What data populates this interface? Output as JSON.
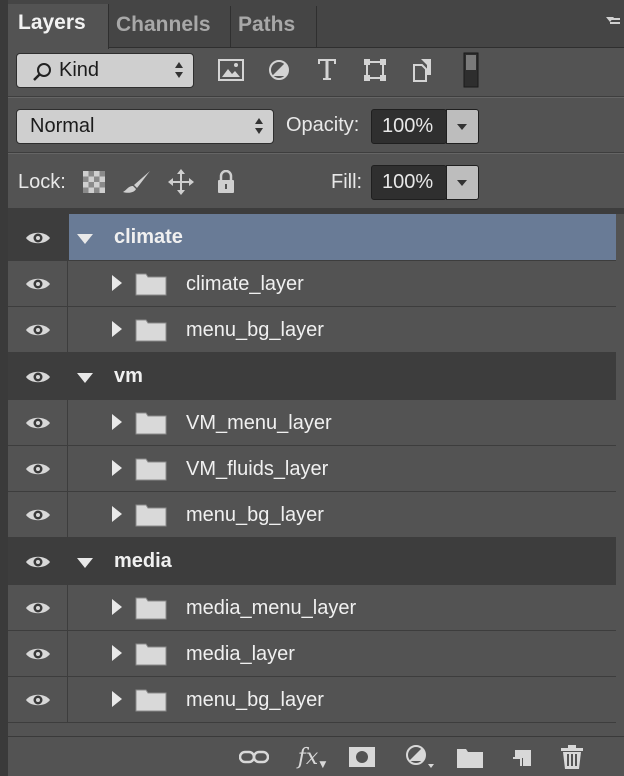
{
  "tabs": [
    {
      "label": "Layers",
      "active": true
    },
    {
      "label": "Channels",
      "active": false
    },
    {
      "label": "Paths",
      "active": false
    }
  ],
  "filter": {
    "kind_label": "Kind",
    "icons": [
      "image-filter-icon",
      "adjustment-filter-icon",
      "type-filter-icon",
      "shape-filter-icon",
      "smart-object-filter-icon",
      "filter-toggle-icon"
    ]
  },
  "blend": {
    "mode": "Normal",
    "opacity_label": "Opacity:",
    "opacity_value": "100%"
  },
  "lock": {
    "label": "Lock:",
    "fill_label": "Fill:",
    "fill_value": "100%"
  },
  "layers": [
    {
      "type": "group",
      "name": "climate",
      "selected": true,
      "expanded": true
    },
    {
      "type": "child",
      "name": "climate_layer"
    },
    {
      "type": "child",
      "name": "menu_bg_layer"
    },
    {
      "type": "group",
      "name": "vm",
      "selected": false,
      "expanded": true
    },
    {
      "type": "child",
      "name": "VM_menu_layer"
    },
    {
      "type": "child",
      "name": "VM_fluids_layer"
    },
    {
      "type": "child",
      "name": "menu_bg_layer"
    },
    {
      "type": "group",
      "name": "media",
      "selected": false,
      "expanded": true
    },
    {
      "type": "child",
      "name": "media_menu_layer"
    },
    {
      "type": "child",
      "name": "media_layer"
    },
    {
      "type": "child",
      "name": "menu_bg_layer"
    }
  ],
  "footer_icons": [
    "link-layers-icon",
    "layer-style-fx-icon",
    "add-mask-icon",
    "adjustment-layer-icon",
    "new-group-icon",
    "new-layer-icon",
    "delete-layer-icon"
  ],
  "colors": {
    "panel_bg": "#535353",
    "group_row_bg": "#3d3d3d",
    "selected_bg": "#697b96"
  }
}
